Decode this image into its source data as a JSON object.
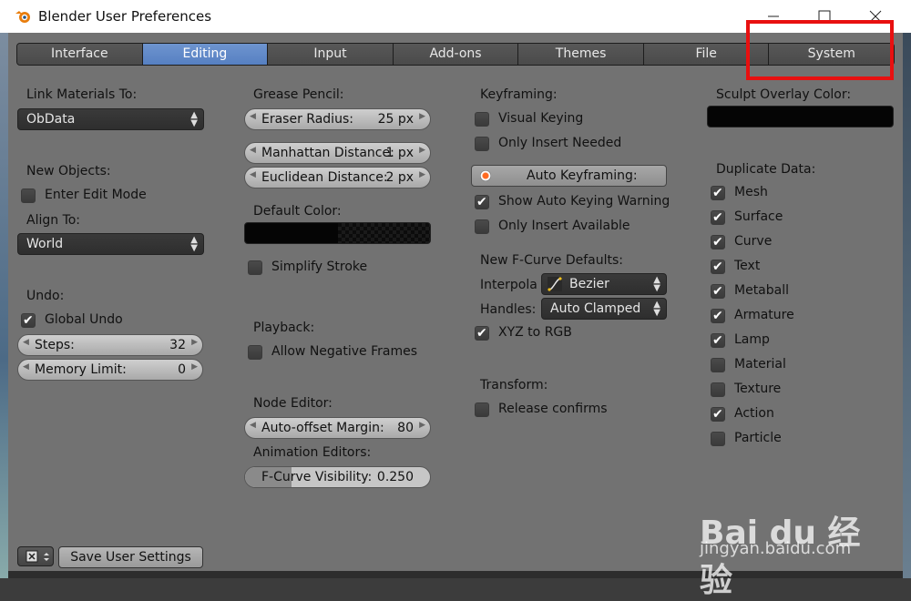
{
  "window": {
    "title": "Blender User Preferences"
  },
  "tabs": [
    {
      "label": "Interface"
    },
    {
      "label": "Editing"
    },
    {
      "label": "Input"
    },
    {
      "label": "Add-ons"
    },
    {
      "label": "Themes"
    },
    {
      "label": "File"
    },
    {
      "label": "System"
    }
  ],
  "active_tab": "Editing",
  "col1": {
    "link_materials_label": "Link Materials To:",
    "link_materials_value": "ObData",
    "new_objects_label": "New Objects:",
    "enter_edit_mode": "Enter Edit Mode",
    "align_to_label": "Align To:",
    "align_to_value": "World",
    "undo_label": "Undo:",
    "global_undo": "Global Undo",
    "steps_label": "Steps:",
    "steps_value": "32",
    "memory_label": "Memory Limit:",
    "memory_value": "0"
  },
  "col2": {
    "grease_pencil_label": "Grease Pencil:",
    "eraser_label": "Eraser Radius:",
    "eraser_value": "25 px",
    "manhattan_label": "Manhattan Distance:",
    "manhattan_value": "1 px",
    "euclidean_label": "Euclidean Distance:",
    "euclidean_value": "2 px",
    "default_color_label": "Default Color:",
    "simplify_stroke": "Simplify Stroke",
    "playback_label": "Playback:",
    "allow_negative": "Allow Negative Frames",
    "node_editor_label": "Node Editor:",
    "auto_offset_label": "Auto-offset Margin:",
    "auto_offset_value": "80",
    "anim_editors_label": "Animation Editors:",
    "fcurve_vis_label": "F-Curve Visibility:",
    "fcurve_vis_value": "0.250",
    "fcurve_vis_fraction": 0.25
  },
  "col3": {
    "keyframing_label": "Keyframing:",
    "visual_keying": "Visual Keying",
    "only_insert_needed": "Only Insert Needed",
    "auto_keyframing": "Auto Keyframing:",
    "show_auto_warning": "Show Auto Keying Warning",
    "only_insert_available": "Only Insert Available",
    "fcurve_defaults_label": "New F-Curve Defaults:",
    "interpola_label": "Interpola",
    "interpola_value": "Bezier",
    "handles_label": "Handles:",
    "handles_value": "Auto Clamped",
    "xyz_to_rgb": "XYZ to RGB",
    "transform_label": "Transform:",
    "release_confirms": "Release confirms"
  },
  "col4": {
    "sculpt_overlay_label": "Sculpt Overlay Color:",
    "duplicate_label": "Duplicate Data:",
    "items": [
      {
        "label": "Mesh",
        "checked": true
      },
      {
        "label": "Surface",
        "checked": true
      },
      {
        "label": "Curve",
        "checked": true
      },
      {
        "label": "Text",
        "checked": true
      },
      {
        "label": "Metaball",
        "checked": true
      },
      {
        "label": "Armature",
        "checked": true
      },
      {
        "label": "Lamp",
        "checked": true
      },
      {
        "label": "Material",
        "checked": false
      },
      {
        "label": "Texture",
        "checked": false
      },
      {
        "label": "Action",
        "checked": true
      },
      {
        "label": "Particle",
        "checked": false
      }
    ]
  },
  "footer": {
    "save_label": "Save User Settings"
  },
  "watermark": {
    "text": "Bai du 经验",
    "url": "jingyan.baidu.com"
  },
  "colors": {
    "accent": "#5680c2",
    "highlight": "#e81010",
    "bg": "#727272"
  }
}
